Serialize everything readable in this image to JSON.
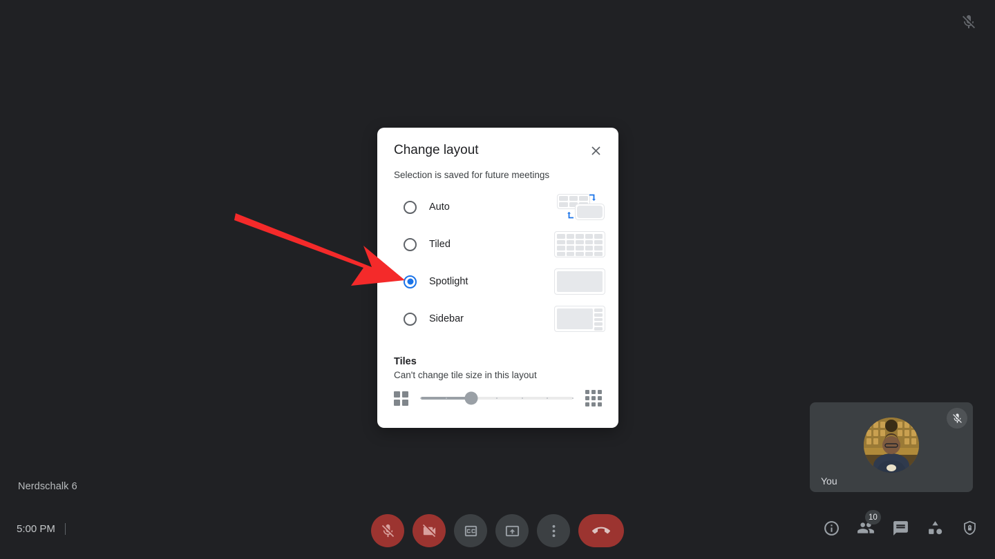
{
  "app": {
    "background_color": "#202124",
    "accent_color": "#1a73e8",
    "danger_color": "#9c3430"
  },
  "meeting": {
    "name": "Nerdschalk 6",
    "time": "5:00 PM"
  },
  "top_bar": {
    "mic_status_icon": "mic-off-icon"
  },
  "dialog": {
    "title": "Change layout",
    "subtitle": "Selection is saved for future meetings",
    "close_icon": "close-icon",
    "options": [
      {
        "label": "Auto",
        "selected": false,
        "preview_icon": "layout-auto-preview"
      },
      {
        "label": "Tiled",
        "selected": false,
        "preview_icon": "layout-tiled-preview"
      },
      {
        "label": "Spotlight",
        "selected": true,
        "preview_icon": "layout-spotlight-preview"
      },
      {
        "label": "Sidebar",
        "selected": false,
        "preview_icon": "layout-sidebar-preview"
      }
    ],
    "tiles": {
      "heading": "Tiles",
      "description": "Can't change tile size in this layout",
      "min_icon": "grid-2x2-icon",
      "max_icon": "grid-3x3-icon",
      "slider_value_percent": 33,
      "slider_disabled": true
    }
  },
  "self_view": {
    "name": "You",
    "mic_status_icon": "mic-off-icon",
    "avatar_icon": "avatar"
  },
  "controls": [
    {
      "name": "microphone-button",
      "icon": "mic-off-icon",
      "state": "muted"
    },
    {
      "name": "camera-button",
      "icon": "camera-off-icon",
      "state": "off"
    },
    {
      "name": "captions-button",
      "icon": "closed-caption-icon",
      "state": "default"
    },
    {
      "name": "present-button",
      "icon": "present-screen-icon",
      "state": "default"
    },
    {
      "name": "more-options-button",
      "icon": "more-vert-icon",
      "state": "default"
    },
    {
      "name": "leave-call-button",
      "icon": "call-end-icon",
      "state": "danger"
    }
  ],
  "right_icons": [
    {
      "name": "meeting-details-button",
      "icon": "info-icon",
      "badge": ""
    },
    {
      "name": "people-button",
      "icon": "people-icon",
      "badge": "10"
    },
    {
      "name": "chat-button",
      "icon": "chat-icon",
      "badge": ""
    },
    {
      "name": "activities-button",
      "icon": "activities-icon",
      "badge": ""
    },
    {
      "name": "host-controls-button",
      "icon": "shield-lock-icon",
      "badge": ""
    }
  ],
  "annotation": {
    "type": "arrow",
    "color": "#f42a2a",
    "points_to": "Spotlight"
  }
}
